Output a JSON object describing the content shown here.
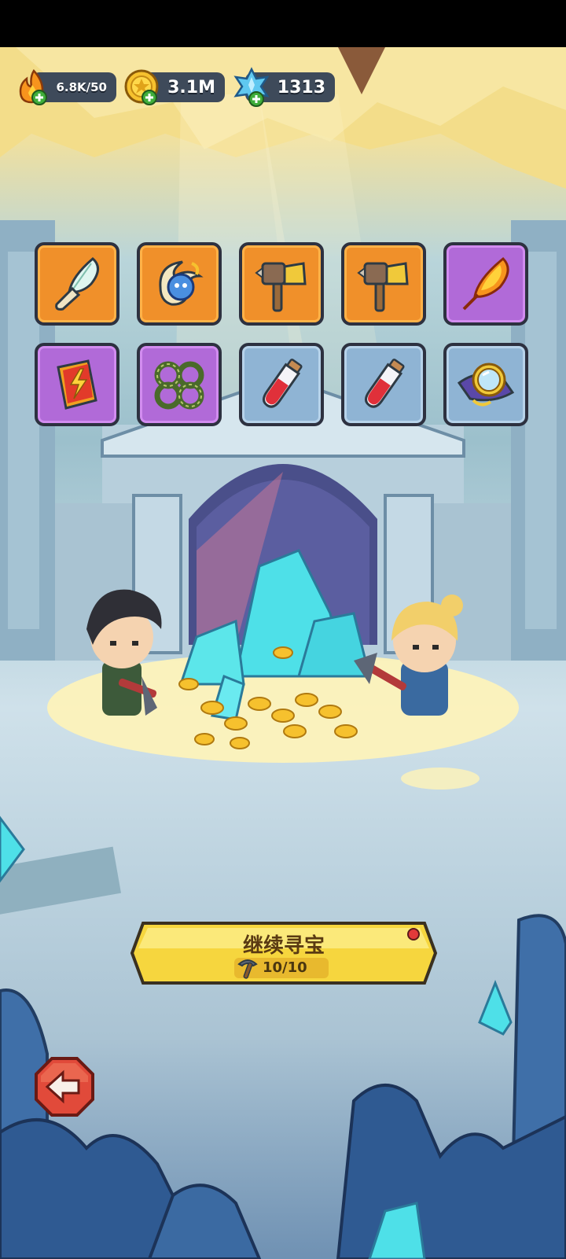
{
  "resources": {
    "energy": {
      "value": "6.8K/50",
      "icon": "fire-icon"
    },
    "gold": {
      "value": "3.1M",
      "icon": "gold-coin-icon"
    },
    "gems": {
      "value": "1313",
      "icon": "blue-crystal-icon"
    }
  },
  "items": [
    {
      "icon": "feather-quill-icon",
      "rarity": "orange"
    },
    {
      "icon": "blue-spirit-orb-icon",
      "rarity": "orange"
    },
    {
      "icon": "hammer-icon",
      "rarity": "orange"
    },
    {
      "icon": "hammer-icon",
      "rarity": "orange"
    },
    {
      "icon": "phoenix-feather-icon",
      "rarity": "purple"
    },
    {
      "icon": "lightning-book-icon",
      "rarity": "purple"
    },
    {
      "icon": "vine-shackles-icon",
      "rarity": "purple"
    },
    {
      "icon": "red-potion-icon",
      "rarity": "blue"
    },
    {
      "icon": "red-potion-icon",
      "rarity": "blue"
    },
    {
      "icon": "golden-mirror-icon",
      "rarity": "blue"
    }
  ],
  "action": {
    "label": "继续寻宝",
    "counter": "10/10",
    "icon": "pickaxe-icon"
  },
  "back": {
    "icon": "back-arrow-icon"
  },
  "colors": {
    "orange": "#f0902a",
    "purple": "#b16ad8",
    "blue": "#8fb4d4",
    "button": "#f6d63e"
  }
}
